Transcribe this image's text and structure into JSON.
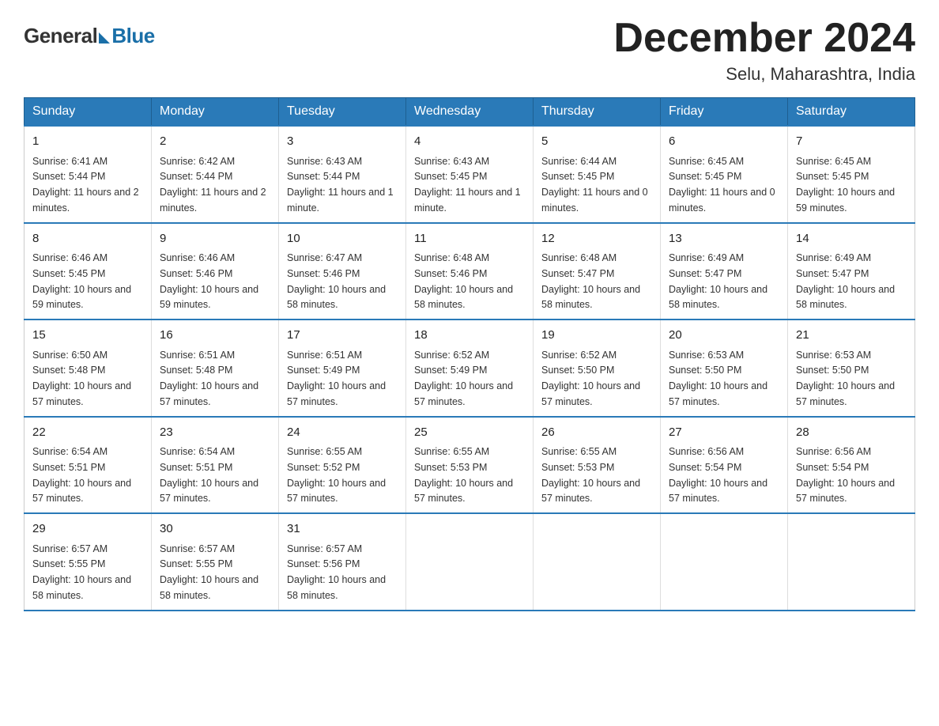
{
  "logo": {
    "general": "General",
    "blue": "Blue"
  },
  "title": "December 2024",
  "subtitle": "Selu, Maharashtra, India",
  "days_of_week": [
    "Sunday",
    "Monday",
    "Tuesday",
    "Wednesday",
    "Thursday",
    "Friday",
    "Saturday"
  ],
  "weeks": [
    [
      {
        "num": "1",
        "sunrise": "6:41 AM",
        "sunset": "5:44 PM",
        "daylight": "11 hours and 2 minutes."
      },
      {
        "num": "2",
        "sunrise": "6:42 AM",
        "sunset": "5:44 PM",
        "daylight": "11 hours and 2 minutes."
      },
      {
        "num": "3",
        "sunrise": "6:43 AM",
        "sunset": "5:44 PM",
        "daylight": "11 hours and 1 minute."
      },
      {
        "num": "4",
        "sunrise": "6:43 AM",
        "sunset": "5:45 PM",
        "daylight": "11 hours and 1 minute."
      },
      {
        "num": "5",
        "sunrise": "6:44 AM",
        "sunset": "5:45 PM",
        "daylight": "11 hours and 0 minutes."
      },
      {
        "num": "6",
        "sunrise": "6:45 AM",
        "sunset": "5:45 PM",
        "daylight": "11 hours and 0 minutes."
      },
      {
        "num": "7",
        "sunrise": "6:45 AM",
        "sunset": "5:45 PM",
        "daylight": "10 hours and 59 minutes."
      }
    ],
    [
      {
        "num": "8",
        "sunrise": "6:46 AM",
        "sunset": "5:45 PM",
        "daylight": "10 hours and 59 minutes."
      },
      {
        "num": "9",
        "sunrise": "6:46 AM",
        "sunset": "5:46 PM",
        "daylight": "10 hours and 59 minutes."
      },
      {
        "num": "10",
        "sunrise": "6:47 AM",
        "sunset": "5:46 PM",
        "daylight": "10 hours and 58 minutes."
      },
      {
        "num": "11",
        "sunrise": "6:48 AM",
        "sunset": "5:46 PM",
        "daylight": "10 hours and 58 minutes."
      },
      {
        "num": "12",
        "sunrise": "6:48 AM",
        "sunset": "5:47 PM",
        "daylight": "10 hours and 58 minutes."
      },
      {
        "num": "13",
        "sunrise": "6:49 AM",
        "sunset": "5:47 PM",
        "daylight": "10 hours and 58 minutes."
      },
      {
        "num": "14",
        "sunrise": "6:49 AM",
        "sunset": "5:47 PM",
        "daylight": "10 hours and 58 minutes."
      }
    ],
    [
      {
        "num": "15",
        "sunrise": "6:50 AM",
        "sunset": "5:48 PM",
        "daylight": "10 hours and 57 minutes."
      },
      {
        "num": "16",
        "sunrise": "6:51 AM",
        "sunset": "5:48 PM",
        "daylight": "10 hours and 57 minutes."
      },
      {
        "num": "17",
        "sunrise": "6:51 AM",
        "sunset": "5:49 PM",
        "daylight": "10 hours and 57 minutes."
      },
      {
        "num": "18",
        "sunrise": "6:52 AM",
        "sunset": "5:49 PM",
        "daylight": "10 hours and 57 minutes."
      },
      {
        "num": "19",
        "sunrise": "6:52 AM",
        "sunset": "5:50 PM",
        "daylight": "10 hours and 57 minutes."
      },
      {
        "num": "20",
        "sunrise": "6:53 AM",
        "sunset": "5:50 PM",
        "daylight": "10 hours and 57 minutes."
      },
      {
        "num": "21",
        "sunrise": "6:53 AM",
        "sunset": "5:50 PM",
        "daylight": "10 hours and 57 minutes."
      }
    ],
    [
      {
        "num": "22",
        "sunrise": "6:54 AM",
        "sunset": "5:51 PM",
        "daylight": "10 hours and 57 minutes."
      },
      {
        "num": "23",
        "sunrise": "6:54 AM",
        "sunset": "5:51 PM",
        "daylight": "10 hours and 57 minutes."
      },
      {
        "num": "24",
        "sunrise": "6:55 AM",
        "sunset": "5:52 PM",
        "daylight": "10 hours and 57 minutes."
      },
      {
        "num": "25",
        "sunrise": "6:55 AM",
        "sunset": "5:53 PM",
        "daylight": "10 hours and 57 minutes."
      },
      {
        "num": "26",
        "sunrise": "6:55 AM",
        "sunset": "5:53 PM",
        "daylight": "10 hours and 57 minutes."
      },
      {
        "num": "27",
        "sunrise": "6:56 AM",
        "sunset": "5:54 PM",
        "daylight": "10 hours and 57 minutes."
      },
      {
        "num": "28",
        "sunrise": "6:56 AM",
        "sunset": "5:54 PM",
        "daylight": "10 hours and 57 minutes."
      }
    ],
    [
      {
        "num": "29",
        "sunrise": "6:57 AM",
        "sunset": "5:55 PM",
        "daylight": "10 hours and 58 minutes."
      },
      {
        "num": "30",
        "sunrise": "6:57 AM",
        "sunset": "5:55 PM",
        "daylight": "10 hours and 58 minutes."
      },
      {
        "num": "31",
        "sunrise": "6:57 AM",
        "sunset": "5:56 PM",
        "daylight": "10 hours and 58 minutes."
      },
      null,
      null,
      null,
      null
    ]
  ],
  "labels": {
    "sunrise": "Sunrise:",
    "sunset": "Sunset:",
    "daylight": "Daylight:"
  }
}
